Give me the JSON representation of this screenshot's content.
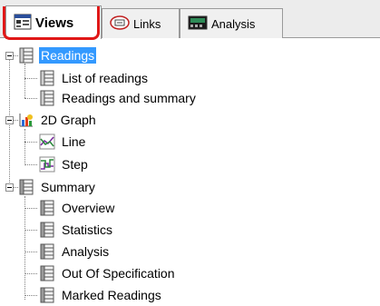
{
  "tabs": [
    {
      "label": "Views",
      "icon": "views-icon",
      "active": true
    },
    {
      "label": "Links",
      "icon": "links-icon",
      "active": false
    },
    {
      "label": "Analysis",
      "icon": "analysis-icon",
      "active": false
    }
  ],
  "tree": {
    "readings": {
      "label": "Readings",
      "children": [
        "List of readings",
        "Readings and summary"
      ]
    },
    "graph": {
      "label": "2D Graph",
      "children": [
        "Line",
        "Step"
      ]
    },
    "summary": {
      "label": "Summary",
      "children": [
        "Overview",
        "Statistics",
        "Analysis",
        "Out Of Specification",
        "Marked Readings"
      ]
    }
  },
  "colors": {
    "selection": "#3399ff",
    "highlight": "#e01818"
  }
}
